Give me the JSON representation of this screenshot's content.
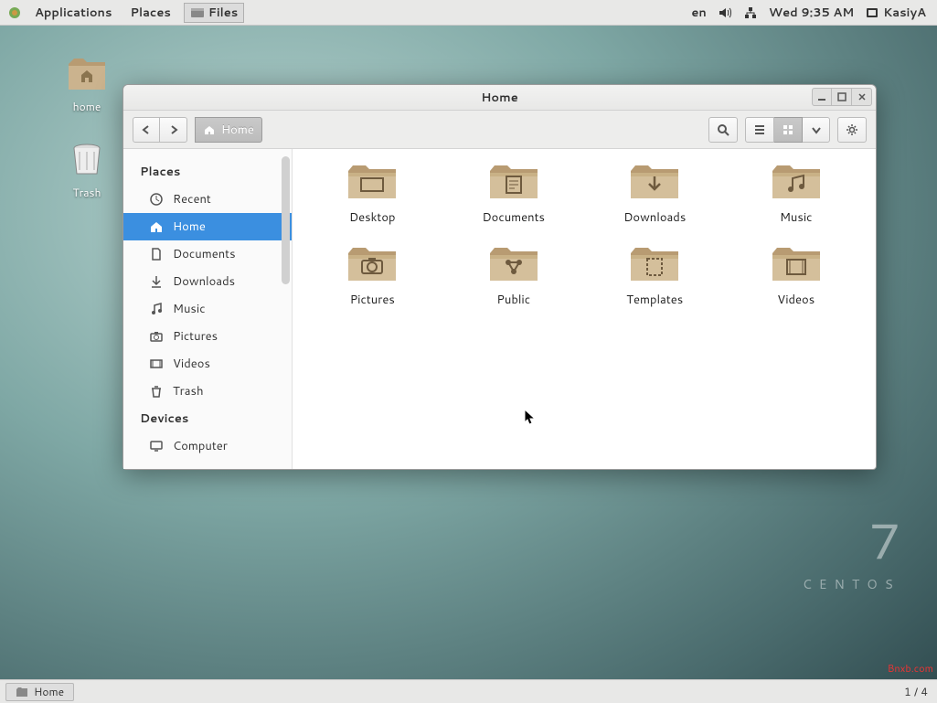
{
  "top_panel": {
    "applications": "Applications",
    "places": "Places",
    "files_app": "Files",
    "lang": "en",
    "datetime": "Wed  9:35 AM",
    "user": "KasiyA"
  },
  "desktop": {
    "home": "home",
    "trash": "Trash"
  },
  "window": {
    "title": "Home",
    "breadcrumb_home": "Home"
  },
  "sidebar": {
    "places_head": "Places",
    "devices_head": "Devices",
    "items": [
      {
        "label": "Recent",
        "icon": "clock"
      },
      {
        "label": "Home",
        "icon": "home"
      },
      {
        "label": "Documents",
        "icon": "document"
      },
      {
        "label": "Downloads",
        "icon": "download"
      },
      {
        "label": "Music",
        "icon": "music"
      },
      {
        "label": "Pictures",
        "icon": "camera"
      },
      {
        "label": "Videos",
        "icon": "video"
      },
      {
        "label": "Trash",
        "icon": "trash"
      }
    ],
    "device_items": [
      {
        "label": "Computer",
        "icon": "computer"
      }
    ]
  },
  "folders": [
    {
      "label": "Desktop"
    },
    {
      "label": "Documents"
    },
    {
      "label": "Downloads"
    },
    {
      "label": "Music"
    },
    {
      "label": "Pictures"
    },
    {
      "label": "Public"
    },
    {
      "label": "Templates"
    },
    {
      "label": "Videos"
    }
  ],
  "bottom": {
    "task": "Home",
    "workspaces": "1 / 4"
  },
  "brand": {
    "seven": "7",
    "name": "CENTOS"
  },
  "watermark": "Bnxb.com"
}
